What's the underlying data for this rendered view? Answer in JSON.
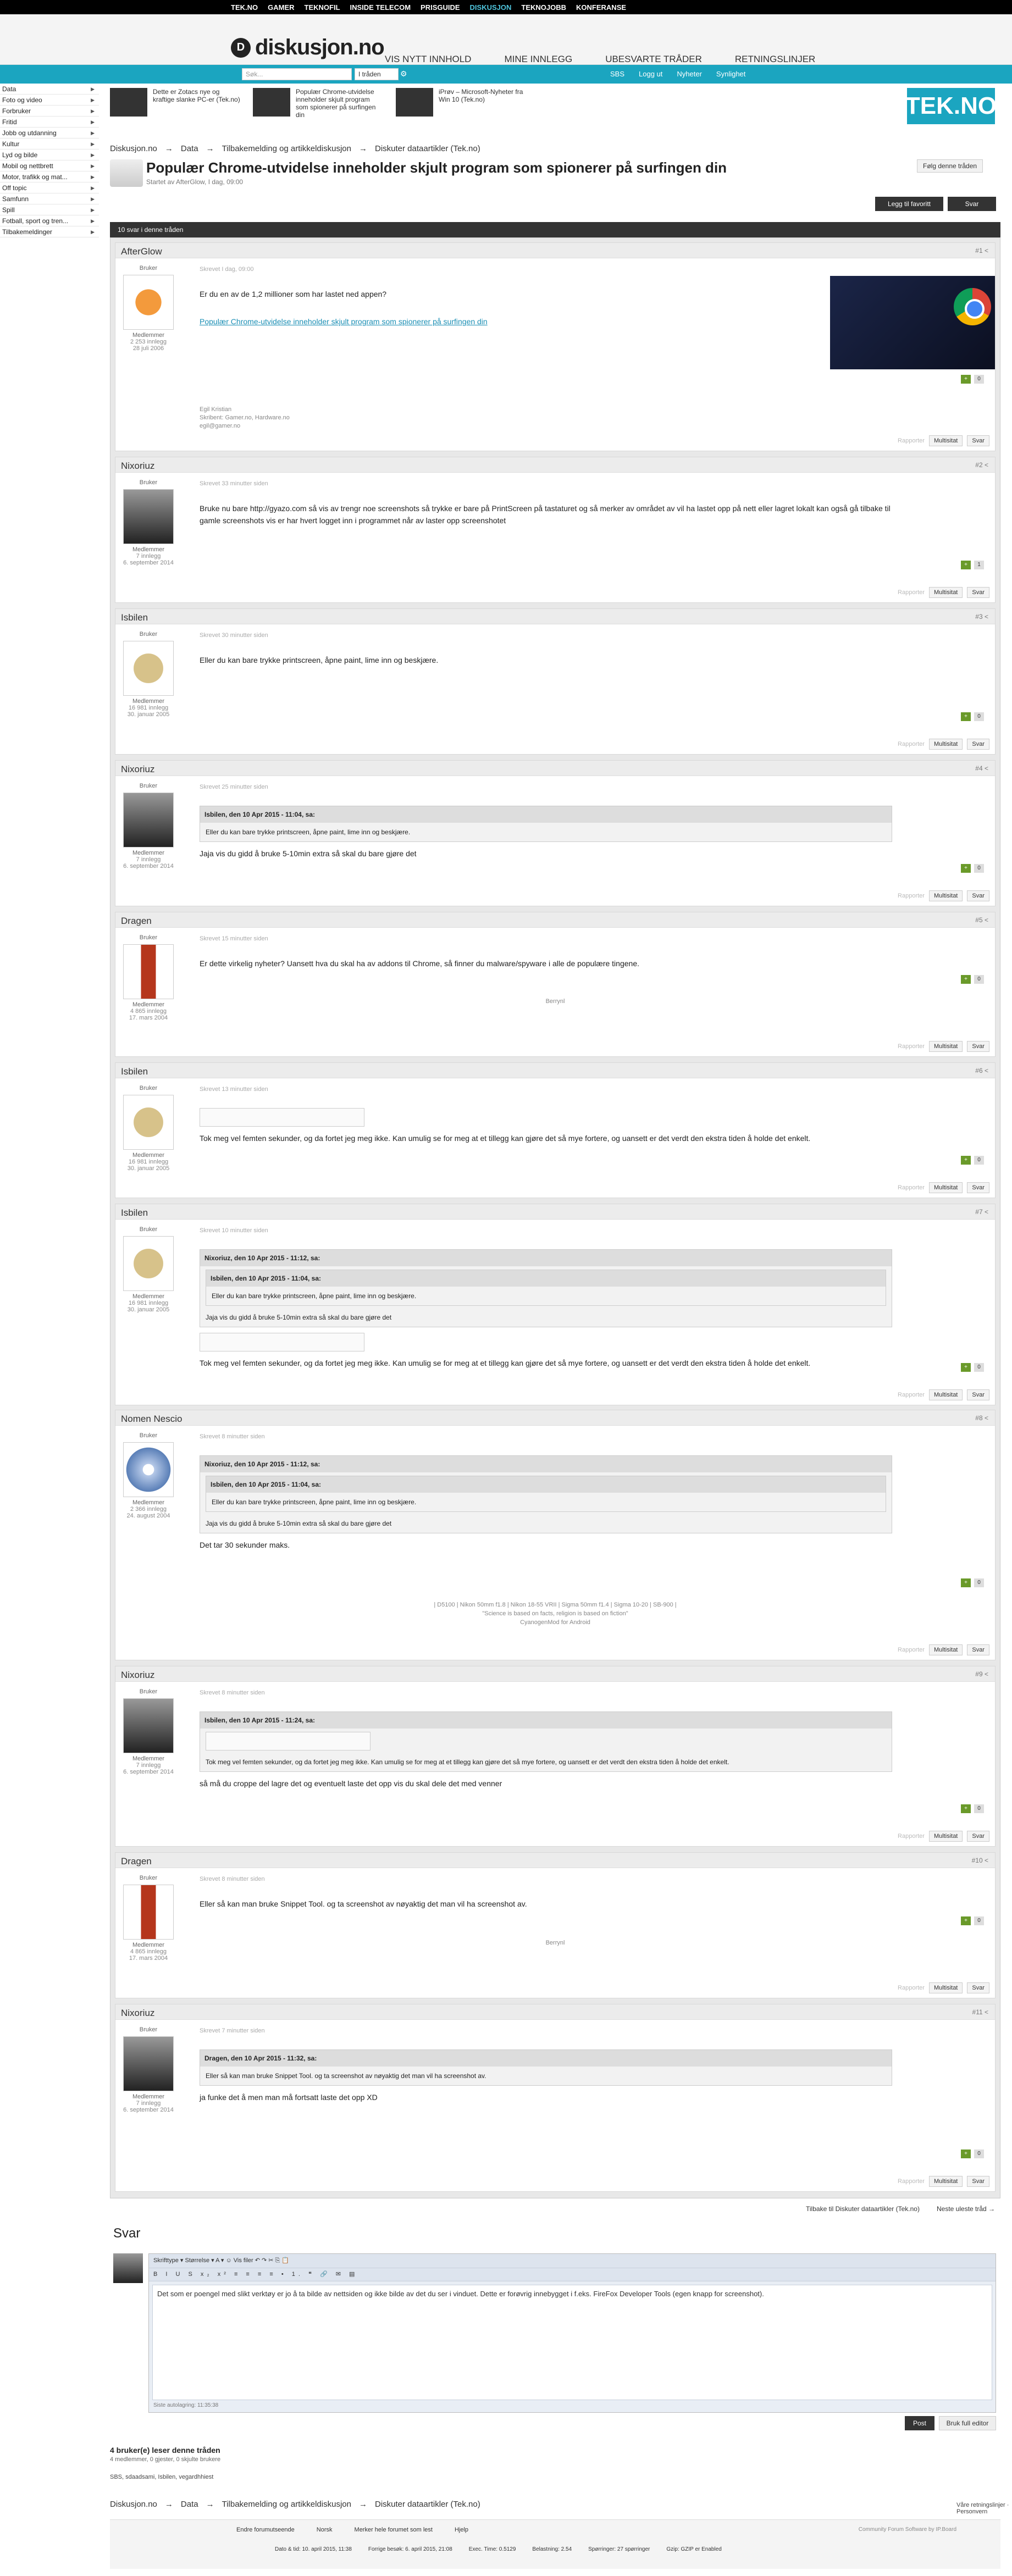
{
  "topnav": [
    "TEK.NO",
    "GAMER",
    "TEKNOFIL",
    "INSIDE TELECOM",
    "PRISGUIDE",
    "DISKUSJON",
    "TEKNOJOBB",
    "KONFERANSE"
  ],
  "topnav_active": "DISKUSJON",
  "header": {
    "logo": "diskusjon.no",
    "nav": [
      "VIS NYTT INNHOLD",
      "MINE INNLEGG",
      "UBESVARTE TRÅDER",
      "RETNINGSLINJER"
    ]
  },
  "subbar": {
    "search_placeholder": "Søk...",
    "search_scope": "I tråden",
    "links": [
      "SBS",
      "Logg ut",
      "Nyheter",
      "Synlighet"
    ]
  },
  "sidebar": [
    "Data",
    "Foto og video",
    "Forbruker",
    "Fritid",
    "Jobb og utdanning",
    "Kultur",
    "Lyd og bilde",
    "Mobil og nettbrett",
    "Motor, trafikk og mat...",
    "Off topic",
    "Samfunn",
    "Spill",
    "Fotball, sport og tren...",
    "Tilbakemeldinger"
  ],
  "ads": [
    {
      "text": "Dette er Zotacs nye og kraftige slanke PC-er (Tek.no)"
    },
    {
      "text": "Populær Chrome-utvidelse inneholder skjult program som spionerer på surfingen din"
    },
    {
      "text": "iPrøv – Microsoft-Nyheter fra Win 10 (Tek.no)"
    }
  ],
  "tekno_logo": "TEK.NO",
  "breadcrumb": [
    "Diskusjon.no",
    "→",
    "Data",
    "→",
    "Tilbakemelding og artikkeldiskusjon",
    "→",
    "Diskuter dataartikler (Tek.no)"
  ],
  "thread": {
    "title": "Populær Chrome-utvidelse inneholder skjult program som spionerer på surfingen din",
    "started": "Startet av AfterGlow, I dag, 09:00",
    "follow": "Følg denne tråden",
    "fav": "Legg til favoritt",
    "reply": "Svar",
    "count": "10 svar i denne tråden"
  },
  "posts": [
    {
      "author": "AfterGlow",
      "num": "#1",
      "role": "Medlemmer",
      "rank": "Bruker",
      "stats": [
        "2 253 innlegg",
        "28 juli 2006"
      ],
      "posted": "Skrevet I dag, 09:00",
      "lines": [
        "Er du en av de 1,2 millioner som har lastet ned appen?"
      ],
      "link": "Populær Chrome-utvidelse inneholder skjult program som spionerer på surfingen din",
      "sig": [
        "Egil Kristian",
        "Skribent: Gamer.no, Hardware.no",
        "egil@gamer.no"
      ],
      "votes": "0"
    },
    {
      "author": "Nixoriuz",
      "num": "#2",
      "role": "Medlemmer",
      "rank": "Bruker",
      "stats": [
        "7 innlegg",
        "6. september 2014"
      ],
      "posted": "Skrevet 33 minutter siden",
      "lines": [
        "Bruke nu bare http://gyazo.com så vis av trengr noe screenshots så trykke er bare på PrintScreen på tastaturet og så merker av området av vil ha lastet opp på nett eller lagret lokalt kan også gå tilbake til gamle screenshots vis er har hvert logget inn i programmet når av laster opp screenshotet"
      ],
      "votes": "1"
    },
    {
      "author": "Isbilen",
      "num": "#3",
      "role": "Medlemmer",
      "rank": "Bruker",
      "stats": [
        "16 981 innlegg",
        "30. januar 2005"
      ],
      "posted": "Skrevet 30 minutter siden",
      "lines": [
        "Eller du kan bare trykke printscreen, åpne paint, lime inn og beskjære."
      ],
      "votes": "0"
    },
    {
      "author": "Nixoriuz",
      "num": "#4",
      "role": "Medlemmer",
      "rank": "Bruker",
      "stats": [
        "7 innlegg",
        "6. september 2014"
      ],
      "posted": "Skrevet 25 minutter siden",
      "quote_head": "Isbilen, den 10 Apr 2015 - 11:04, sa:",
      "quote_body": "Eller du kan bare trykke printscreen, åpne paint, lime inn og beskjære.",
      "lines": [
        "Jaja vis du gidd å bruke 5-10min extra så skal du bare gjøre det"
      ],
      "votes": "0"
    },
    {
      "author": "Dragen",
      "num": "#5",
      "role": "Medlemmer",
      "rank": "Bruker",
      "stats": [
        "4 865 innlegg",
        "17. mars 2004"
      ],
      "posted": "Skrevet 15 minutter siden",
      "lines": [
        "Er dette virkelig nyheter? Uansett hva du skal ha av addons til Chrome, så finner du malware/spyware i alle de populære tingene."
      ],
      "sig_center": [
        "Berrynl"
      ],
      "votes": "0"
    },
    {
      "author": "Isbilen",
      "num": "#6",
      "role": "Medlemmer",
      "rank": "Bruker",
      "stats": [
        "16 981 innlegg",
        "30. januar 2005"
      ],
      "posted": "Skrevet 13 minutter siden",
      "lines": [
        "Tok meg vel femten sekunder, og da fortet jeg meg ikke. Kan umulig se for meg at et tillegg kan gjøre det så mye fortere, og uansett er det verdt den ekstra tiden å holde det enkelt."
      ],
      "votes": "0"
    },
    {
      "author": "Isbilen",
      "num": "#7",
      "role": "Medlemmer",
      "rank": "Bruker",
      "stats": [
        "16 981 innlegg",
        "30. januar 2005"
      ],
      "posted": "Skrevet 10 minutter siden",
      "quote_head": "Nixoriuz, den 10 Apr 2015 - 11:12, sa:",
      "nested_head": "Isbilen, den 10 Apr 2015 - 11:04, sa:",
      "nested_body": "Eller du kan bare trykke printscreen, åpne paint, lime inn og beskjære.",
      "quote_body": "Jaja vis du gidd å bruke 5-10min extra så skal du bare gjøre det",
      "lines": [
        "Tok meg vel femten sekunder, og da fortet jeg meg ikke. Kan umulig se for meg at et tillegg kan gjøre det så mye fortere, og uansett er det verdt den ekstra tiden å holde det enkelt."
      ],
      "votes": "0"
    },
    {
      "author": "Nomen Nescio",
      "num": "#8",
      "role": "Medlemmer",
      "rank": "Bruker",
      "stats": [
        "2 366 innlegg",
        "24. august 2004"
      ],
      "posted": "Skrevet 8 minutter siden",
      "quote_head": "Nixoriuz, den 10 Apr 2015 - 11:12, sa:",
      "nested_head": "Isbilen, den 10 Apr 2015 - 11:04, sa:",
      "nested_body": "Eller du kan bare trykke printscreen, åpne paint, lime inn og beskjære.",
      "quote_body": "Jaja vis du gidd å bruke 5-10min extra så skal du bare gjøre det",
      "lines": [
        "Det tar 30 sekunder maks."
      ],
      "sig_center": [
        "| D5100 | Nikon 50mm f1.8 | Nikon 18-55 VRII | Sigma 50mm f1.4 | Sigma 10-20 | SB-900 |",
        "\"Science is based on facts, religion is based on fiction\"",
        "CyanogenMod for Android"
      ],
      "votes": "0"
    },
    {
      "author": "Nixoriuz",
      "num": "#9",
      "role": "Medlemmer",
      "rank": "Bruker",
      "stats": [
        "7 innlegg",
        "6. september 2014"
      ],
      "posted": "Skrevet 8 minutter siden",
      "quote_head": "Isbilen, den 10 Apr 2015 - 11:24, sa:",
      "quote_body": "Tok meg vel femten sekunder, og da fortet jeg meg ikke. Kan umulig se for meg at et tillegg kan gjøre det så mye fortere, og uansett er det verdt den ekstra tiden å holde det enkelt.",
      "lines": [
        "så må du croppe del lagre det og eventuelt laste det opp vis du skal dele det med venner"
      ],
      "votes": "0"
    },
    {
      "author": "Dragen",
      "num": "#10",
      "role": "Medlemmer",
      "rank": "Bruker",
      "stats": [
        "4 865 innlegg",
        "17. mars 2004"
      ],
      "posted": "Skrevet 8 minutter siden",
      "lines": [
        "Eller så kan man bruke Snippet Tool. og ta screenshot av nøyaktig det man vil ha screenshot av."
      ],
      "sig_center": [
        "Berrynl"
      ],
      "votes": "0"
    },
    {
      "author": "Nixoriuz",
      "num": "#11",
      "role": "Medlemmer",
      "rank": "Bruker",
      "stats": [
        "7 innlegg",
        "6. september 2014"
      ],
      "posted": "Skrevet 7 minutter siden",
      "quote_head": "Dragen, den 10 Apr 2015 - 11:32, sa:",
      "quote_body": "Eller så kan man bruke Snippet Tool. og ta screenshot av nøyaktig det man vil ha screenshot av.",
      "lines": [
        "ja funke det å men man må fortsatt laste det opp XD"
      ],
      "votes": "0"
    }
  ],
  "post_actions": {
    "report": "Rapporter",
    "multiquote": "Multisitat",
    "reply": "Svar"
  },
  "below_thread": {
    "back": "Tilbake til Diskuter dataartikler (Tek.no)",
    "next": "Neste uleste tråd →"
  },
  "reply_box": {
    "heading": "Svar",
    "toolbar1": "Skrifttype ▾   Størrelse ▾   A ▾   ☺   Vis filer   ↶ ↷   ✂ ⎘ 📋",
    "toolbar2": "B I U S x₂ x² ≡ ≡ ≡ ≡ • 1. ❝ 🔗 ✉ ▤",
    "text": "Det som er poengel med slikt verktøy er jo å ta bilde av nettsiden og ikke bilde av det du ser i vinduet. Dette er forøvrig innebygget i f.eks. FireFox Developer Tools (egen knapp for screenshot).",
    "autosave": "Siste autolagring: 11:35:38",
    "post": "Post",
    "more": "Bruk full editor"
  },
  "readers": {
    "title": "4 bruker(e) leser denne tråden",
    "summary": "4 medlemmer, 0 gjester, 0 skjulte brukere",
    "users": "SBS, sdaadsami, Isbilen, vegardhhiest"
  },
  "rules": "Våre retningslinjer · Personvern",
  "footer": {
    "links": [
      "Endre forumutseende",
      "Norsk",
      "Merker hele forumet som lest",
      "Hjelp"
    ],
    "right": "Community Forum Software by IP.Board",
    "stats": [
      "Dato & tid: 10. april 2015, 11:38",
      "Forrige besøk: 6. april 2015, 21:08",
      "Exec. Time: 0.5129",
      "Belastning: 2.54",
      "Spørringer: 27 spørringer",
      "Gzip: GZIP er Enabled"
    ]
  }
}
